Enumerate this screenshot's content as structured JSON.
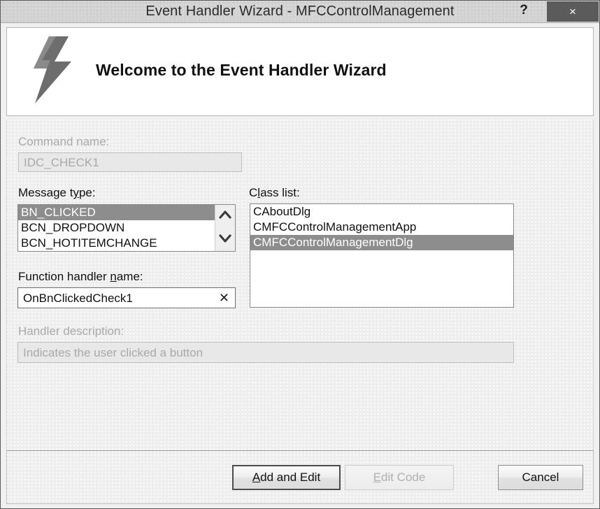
{
  "window": {
    "title": "Event Handler Wizard - MFCControlManagement",
    "help_button": "?",
    "close_button": "×"
  },
  "banner": {
    "heading": "Welcome to the Event Handler Wizard",
    "icon": "lightning-bolt-icon"
  },
  "command_name": {
    "label": "Command name:",
    "value": "IDC_CHECK1",
    "disabled": true
  },
  "message_type": {
    "label_before": "Message t",
    "label_accel": "y",
    "label_after": "pe:",
    "items": [
      "BN_CLICKED",
      "BCN_DROPDOWN",
      "BCN_HOTITEMCHANGE"
    ],
    "selected_index": 0,
    "scroll_up_icon": "chevron-up-icon",
    "scroll_down_icon": "chevron-down-icon"
  },
  "class_list": {
    "label_before": "C",
    "label_accel": "l",
    "label_after": "ass list:",
    "items": [
      "CAboutDlg",
      "CMFCControlManagementApp",
      "CMFCControlManagementDlg"
    ],
    "selected_index": 2
  },
  "function_handler": {
    "label_before": "Function handler ",
    "label_accel": "n",
    "label_after": "ame:",
    "value": "OnBnClickedCheck1",
    "clear_icon": "✕"
  },
  "handler_description": {
    "label": "Handler description:",
    "value": "Indicates the user clicked a button",
    "disabled": true
  },
  "footer": {
    "add_and_edit": {
      "before": "",
      "accel": "A",
      "after": "dd and Edit",
      "is_default": true
    },
    "edit_code": {
      "before": "",
      "accel": "E",
      "after": "dit Code",
      "disabled": true
    },
    "cancel": {
      "label": "Cancel"
    }
  },
  "colors": {
    "titlebar": "#d2d2d2",
    "close_button_bg": "#5b5b5b",
    "selection": "#8d8d8d",
    "body_bg": "#eeeeee",
    "banner_bg": "#ffffff"
  }
}
